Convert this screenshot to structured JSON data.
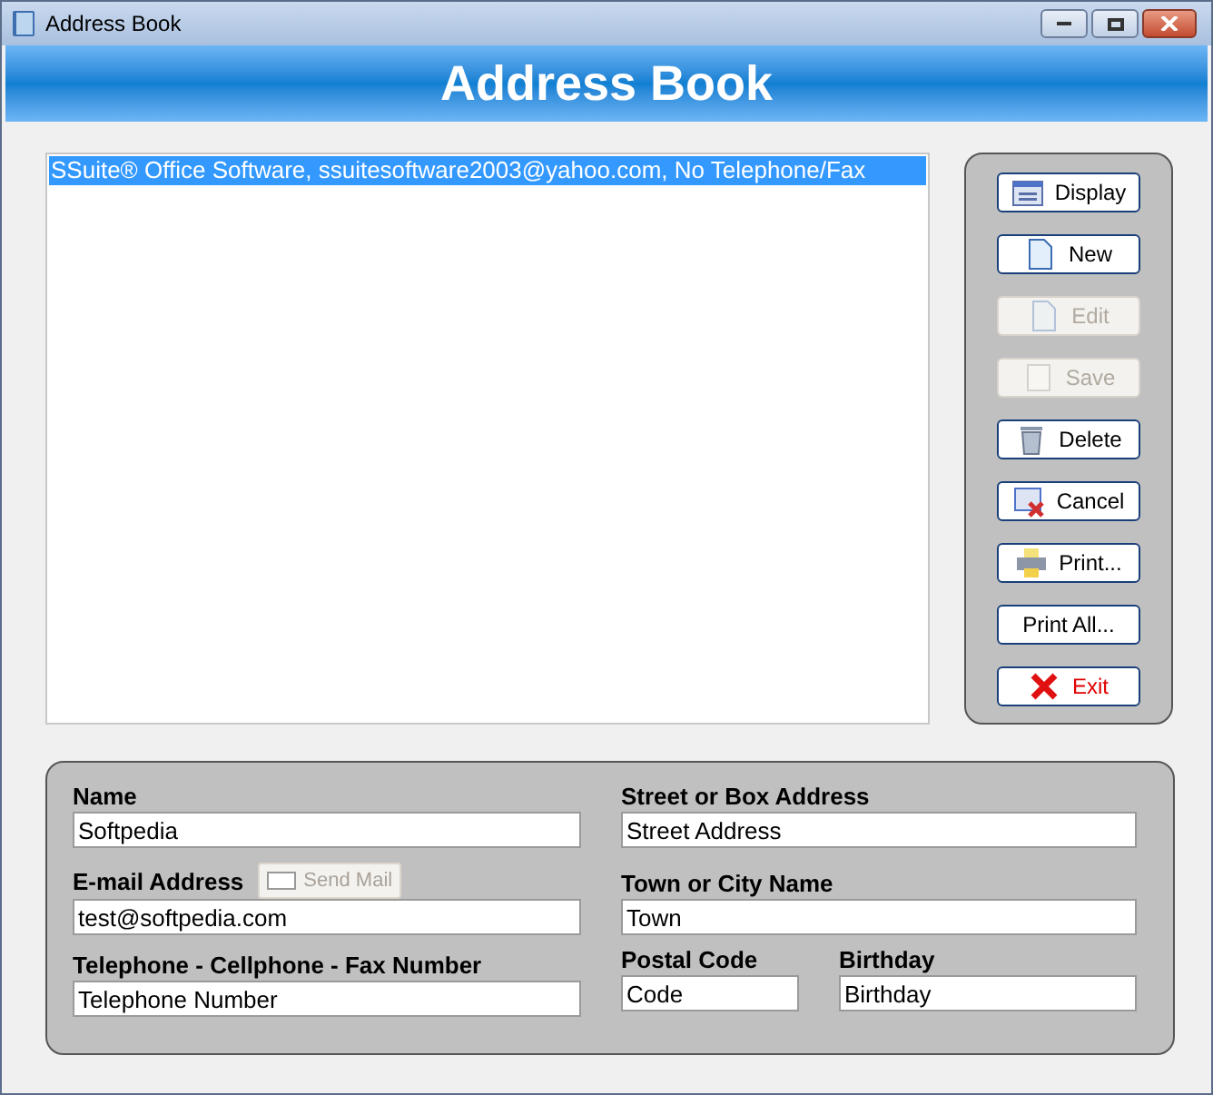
{
  "window": {
    "title": "Address Book"
  },
  "header": "Address Book",
  "list": [
    {
      "text": "SSuite® Office Software, ssuitesoftware2003@yahoo.com, No Telephone/Fax",
      "selected": true
    }
  ],
  "buttons": [
    {
      "label": "Display",
      "kind": "display",
      "disabled": false
    },
    {
      "label": "New",
      "kind": "new",
      "disabled": false
    },
    {
      "label": "Edit",
      "kind": "edit",
      "disabled": true
    },
    {
      "label": "Save",
      "kind": "save",
      "disabled": true
    },
    {
      "label": "Delete",
      "kind": "delete",
      "disabled": false
    },
    {
      "label": "Cancel",
      "kind": "cancel",
      "disabled": false
    },
    {
      "label": "Print...",
      "kind": "print",
      "disabled": false
    },
    {
      "label": "Print All...",
      "kind": "plain",
      "disabled": false
    },
    {
      "label": "Exit",
      "kind": "exit",
      "disabled": false
    }
  ],
  "form": {
    "name": {
      "label": "Name",
      "value": "Softpedia"
    },
    "email": {
      "label": "E-mail Address",
      "value": "test@softpedia.com"
    },
    "send_mail": {
      "label": "Send Mail",
      "disabled": true
    },
    "phone": {
      "label": "Telephone - Cellphone - Fax Number",
      "value": "Telephone Number"
    },
    "street": {
      "label": "Street or Box Address",
      "value": "Street Address"
    },
    "town": {
      "label": "Town or City Name",
      "value": "Town"
    },
    "postal": {
      "label": "Postal Code",
      "value": "Code"
    },
    "birthday": {
      "label": "Birthday",
      "value": "Birthday"
    }
  }
}
